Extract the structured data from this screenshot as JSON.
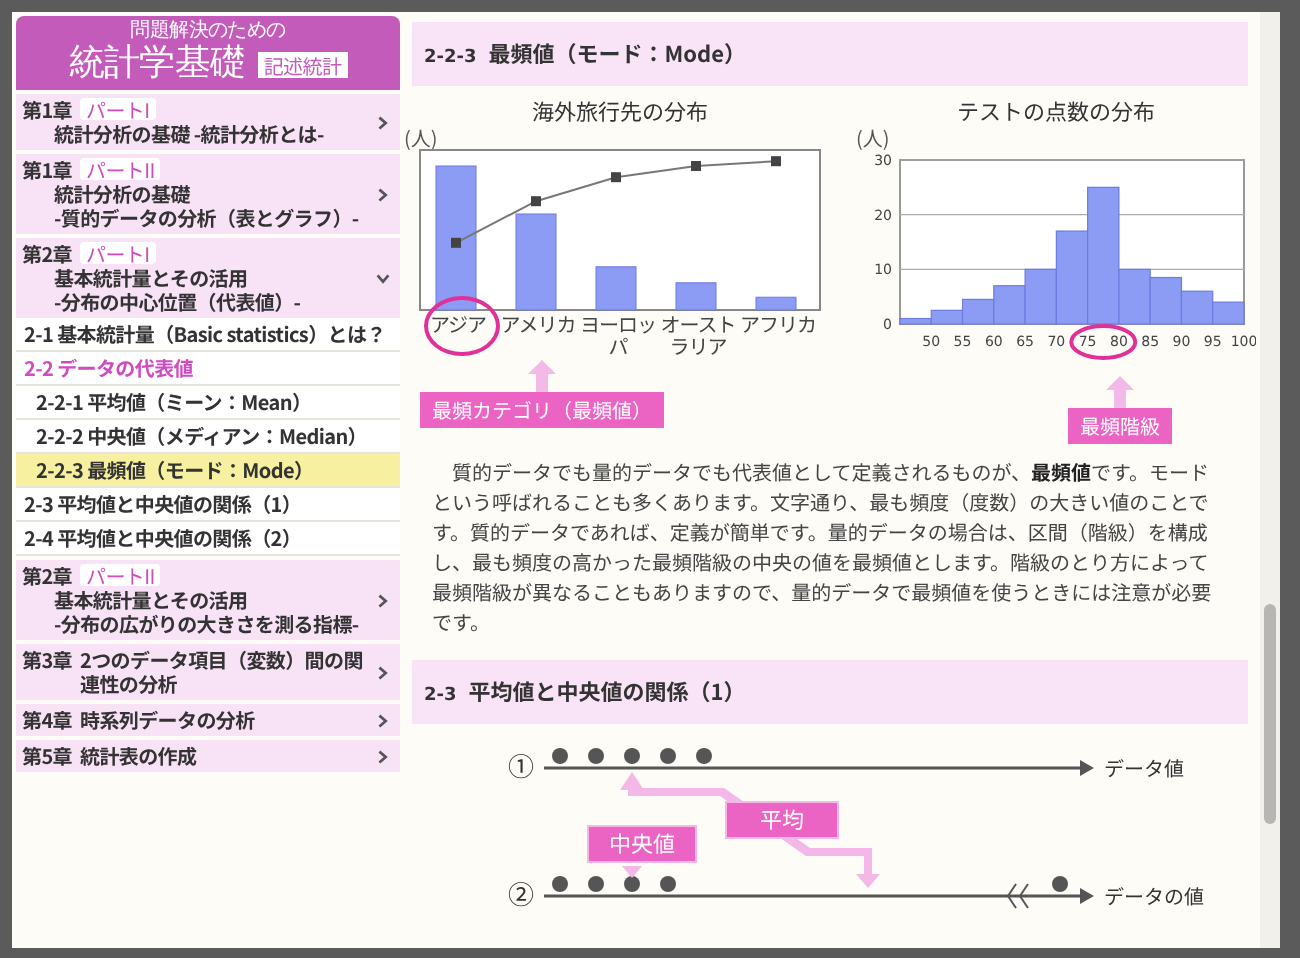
{
  "sidebar": {
    "brand": {
      "subtitle": "問題解決のための",
      "title": "統計学基礎",
      "tag": "記述統計"
    },
    "chapters": [
      {
        "chapter": "第1章",
        "part": "パートI",
        "lines": [
          "統計分析の基礎 -統計分析とは-"
        ],
        "expanded": false
      },
      {
        "chapter": "第1章",
        "part": "パートII",
        "lines": [
          "統計分析の基礎",
          "-質的データの分析（表とグラフ）-"
        ],
        "expanded": false
      },
      {
        "chapter": "第2章",
        "part": "パートI",
        "lines": [
          "基本統計量とその活用",
          "-分布の中心位置（代表値）-"
        ],
        "expanded": true,
        "children": [
          {
            "label": "2-1 基本統計量（Basic statistics）とは？",
            "selected": false,
            "expanded": false
          },
          {
            "label": "2-2 データの代表値",
            "selected": false,
            "expanded": true,
            "children": [
              {
                "label": "2-2-1 平均値（ミーン：Mean）",
                "selected": false
              },
              {
                "label": "2-2-2 中央値（メディアン：Median）",
                "selected": false
              },
              {
                "label": "2-2-3 最頻値（モード：Mode）",
                "selected": true
              }
            ]
          },
          {
            "label": "2-3 平均値と中央値の関係（1）",
            "selected": false,
            "expanded": false
          },
          {
            "label": "2-4 平均値と中央値の関係（2）",
            "selected": false,
            "expanded": false
          }
        ]
      },
      {
        "chapter": "第2章",
        "part": "パートII",
        "lines": [
          "基本統計量とその活用",
          "-分布の広がりの大きさを測る指標-"
        ],
        "expanded": false
      },
      {
        "chapter": "第3章",
        "lines": [
          "2つのデータ項目（変数）間の関連性の分析"
        ],
        "expanded": false
      },
      {
        "chapter": "第4章",
        "lines": [
          "時系列データの分析"
        ],
        "expanded": false
      },
      {
        "chapter": "第5章",
        "lines": [
          "統計表の作成"
        ],
        "expanded": false
      }
    ]
  },
  "main": {
    "section": {
      "number": "2-2-3",
      "title": "最頻値（モード：Mode）"
    },
    "figure": {
      "left": {
        "title": "海外旅行先の分布",
        "unit": "(人)",
        "categories": [
          "アジア",
          "アメリカ",
          "ヨーロッパ",
          "オーストラリア",
          "アフリカ"
        ],
        "callout": "最頻カテゴリ（最頻値）"
      },
      "right": {
        "callout": "最頻階級",
        "chart_data": {
          "type": "bar",
          "title": "テストの点数の分布",
          "ylabel": "(人)",
          "x": [
            47.5,
            52.5,
            57.5,
            62.5,
            67.5,
            72.5,
            77.5,
            82.5,
            87.5,
            92.5,
            97.5
          ],
          "values": [
            1,
            2.5,
            4.5,
            7,
            10,
            17,
            25,
            10,
            8.5,
            6,
            4
          ],
          "xlim": [
            45,
            100
          ],
          "ylim": [
            0,
            30
          ],
          "xticks": [
            50,
            55,
            60,
            65,
            70,
            75,
            80,
            85,
            90,
            95,
            100
          ],
          "yticks": [
            0,
            10,
            20,
            30
          ]
        }
      }
    },
    "paragraph": "質的データでも量的データでも代表値として定義されるものが、**最頻値**です。モードという呼ばれることも多くあります。文字通り、最も頻度（度数）の大きい値のことです。質的データであれば、定義が簡単です。量的データの場合は、区間（階級）を構成し、最も頻度の高かった最頻階級の中央の値を最頻値とします。階級のとり方によって最頻階級が異なることもありますので、量的データで最頻値を使うときには注意が必要です。",
    "next_section": {
      "number": "2-3",
      "title": "平均値と中央値の関係（1）"
    },
    "diagram": {
      "rows": [
        {
          "marker": "①",
          "axis_label": "データ値"
        },
        {
          "marker": "②",
          "axis_label": "データの値"
        }
      ],
      "callouts": [
        "中央値",
        "平均"
      ]
    }
  }
}
